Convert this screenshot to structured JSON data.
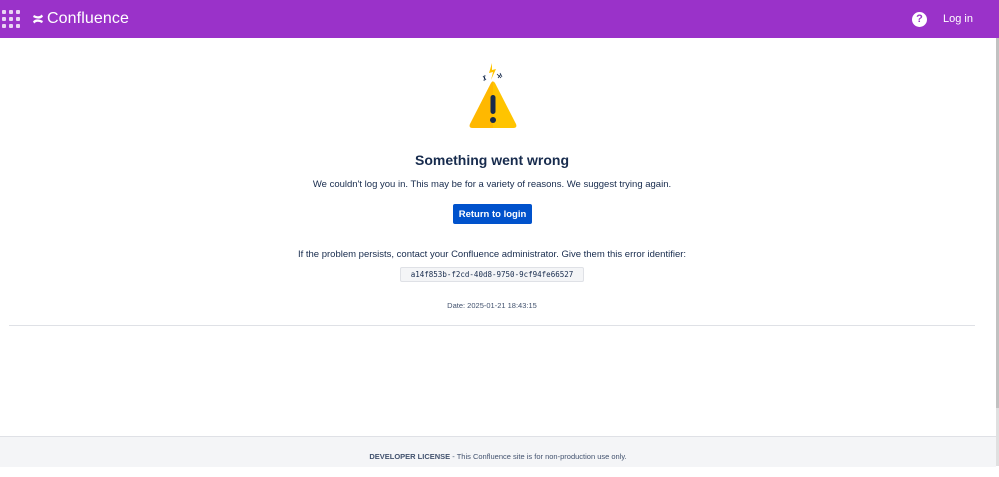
{
  "header": {
    "app_name": "Confluence",
    "login_label": "Log in",
    "help_symbol": "?",
    "brand_color": "#9a32c9"
  },
  "error": {
    "title": "Something went wrong",
    "message": "We couldn't log you in. This may be for a variety of reasons. We suggest trying again.",
    "button_label": "Return to login",
    "persist_message": "If the problem persists, contact your Confluence administrator. Give them this error identifier:",
    "identifier": "a14f853b-f2cd-40d8-9750-9cf94fe66527",
    "date": "Date: 2025-01-21 18:43:15",
    "button_color": "#0052cc"
  },
  "footer": {
    "license_label": "DEVELOPER LICENSE",
    "license_text": " - This Confluence site is for non-production use only."
  },
  "icons": {
    "app_switcher": "grid-icon",
    "logo": "confluence-logo-icon",
    "help": "help-icon",
    "warning": "warning-icon"
  }
}
